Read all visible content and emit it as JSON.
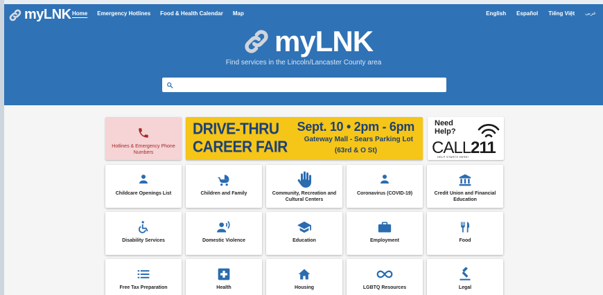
{
  "header": {
    "logo_text": "myLNK",
    "nav": [
      "Home",
      "Emergency Hotlines",
      "Food & Health Calendar",
      "Map"
    ],
    "languages": [
      "English",
      "Español",
      "Tiếng Việt",
      "عربى"
    ],
    "hero_logo_text": "myLNK",
    "tagline": "Find services in the Lincoln/Lancaster County area",
    "search": {
      "placeholder": "",
      "value": ""
    }
  },
  "banners": {
    "hotline_label": "Hotlines & Emergency Phone Numbers",
    "career_fair": {
      "line1": "DRIVE-THRU",
      "line2": "CAREER FAIR",
      "date": "Sept. 10 • 2pm - 6pm",
      "place": "Gateway Mall - Sears Parking Lot",
      "address": "(63rd & O St)"
    },
    "call211": {
      "need": "Need",
      "help": "Help?",
      "call": "CALL",
      "number": "211",
      "tagline": "HELP STARTS HERE!"
    }
  },
  "tiles": [
    {
      "label": "Childcare Openings List",
      "icon": "person-icon"
    },
    {
      "label": "Children and Family",
      "icon": "stroller-icon"
    },
    {
      "label": "Community, Recreation and Cultural Centers",
      "icon": "hand-icon"
    },
    {
      "label": "Coronavirus (COVID-19)",
      "icon": "person-icon"
    },
    {
      "label": "Credit Union and Financial Education",
      "icon": "bank-icon"
    },
    {
      "label": "Disability Services",
      "icon": "wheelchair-icon"
    },
    {
      "label": "Domestic Violence",
      "icon": "speaking-person-icon"
    },
    {
      "label": "Education",
      "icon": "graduation-cap-icon"
    },
    {
      "label": "Employment",
      "icon": "briefcase-icon"
    },
    {
      "label": "Food",
      "icon": "utensils-icon"
    },
    {
      "label": "Free Tax Preparation",
      "icon": "list-icon"
    },
    {
      "label": "Health",
      "icon": "medical-cross-icon"
    },
    {
      "label": "Housing",
      "icon": "home-icon"
    },
    {
      "label": "LGBTQ Resources",
      "icon": "infinity-icon"
    },
    {
      "label": "Legal",
      "icon": "gavel-icon"
    }
  ],
  "colors": {
    "header_bg": "#2f72b6",
    "icon_blue": "#2a6cb0",
    "hotline_bg": "#f6d3d5",
    "hotline_red": "#a32a2a",
    "career_bg": "#f5c518",
    "career_text": "#1d4174"
  }
}
